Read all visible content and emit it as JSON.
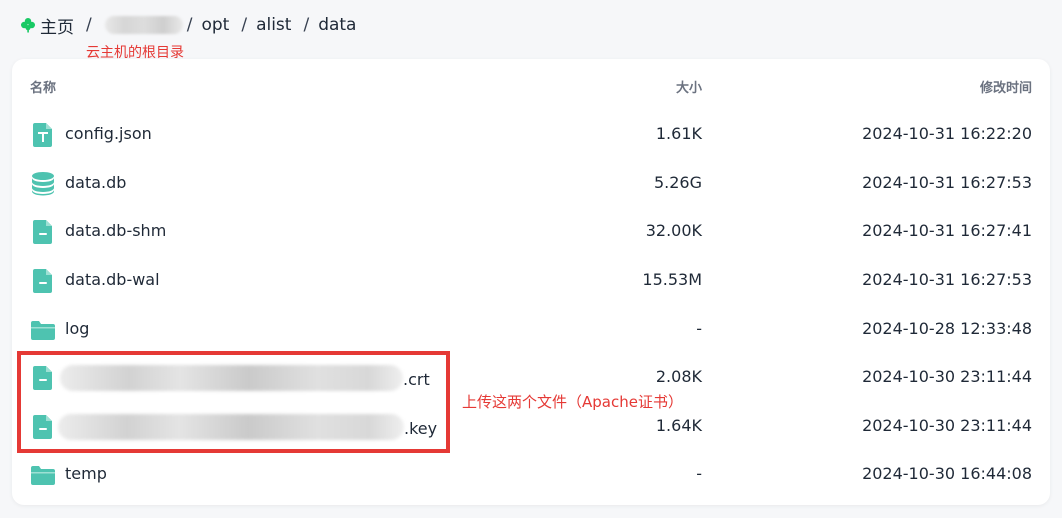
{
  "breadcrumb": {
    "home_label": "主页",
    "separator": "/",
    "items": [
      "opt",
      "alist",
      "data"
    ]
  },
  "annotations": {
    "root_note": "云主机的根目录",
    "upload_note": "上传这两个文件（Apache证书）"
  },
  "table": {
    "headers": {
      "name": "名称",
      "size": "大小",
      "modified": "修改时间"
    },
    "rows": [
      {
        "name": "config.json",
        "size": "1.61K",
        "modified": "2024-10-31 16:22:20",
        "icon": "text-file-icon"
      },
      {
        "name": "data.db",
        "size": "5.26G",
        "modified": "2024-10-31 16:27:53",
        "icon": "database-icon"
      },
      {
        "name": "data.db-shm",
        "size": "32.00K",
        "modified": "2024-10-31 16:27:41",
        "icon": "file-icon"
      },
      {
        "name": "data.db-wal",
        "size": "15.53M",
        "modified": "2024-10-31 16:27:53",
        "icon": "file-icon"
      },
      {
        "name": "log",
        "size": "-",
        "modified": "2024-10-28 12:33:48",
        "icon": "folder-icon"
      },
      {
        "name": ".crt",
        "size": "2.08K",
        "modified": "2024-10-30 23:11:44",
        "icon": "file-icon"
      },
      {
        "name": ".key",
        "size": "1.64K",
        "modified": "2024-10-30 23:11:44",
        "icon": "file-icon"
      },
      {
        "name": "temp",
        "size": "-",
        "modified": "2024-10-30 16:44:08",
        "icon": "folder-icon"
      }
    ]
  },
  "colors": {
    "accent": "#4ec3b0",
    "annotation": "#e53935",
    "home_icon": "#18c964"
  }
}
